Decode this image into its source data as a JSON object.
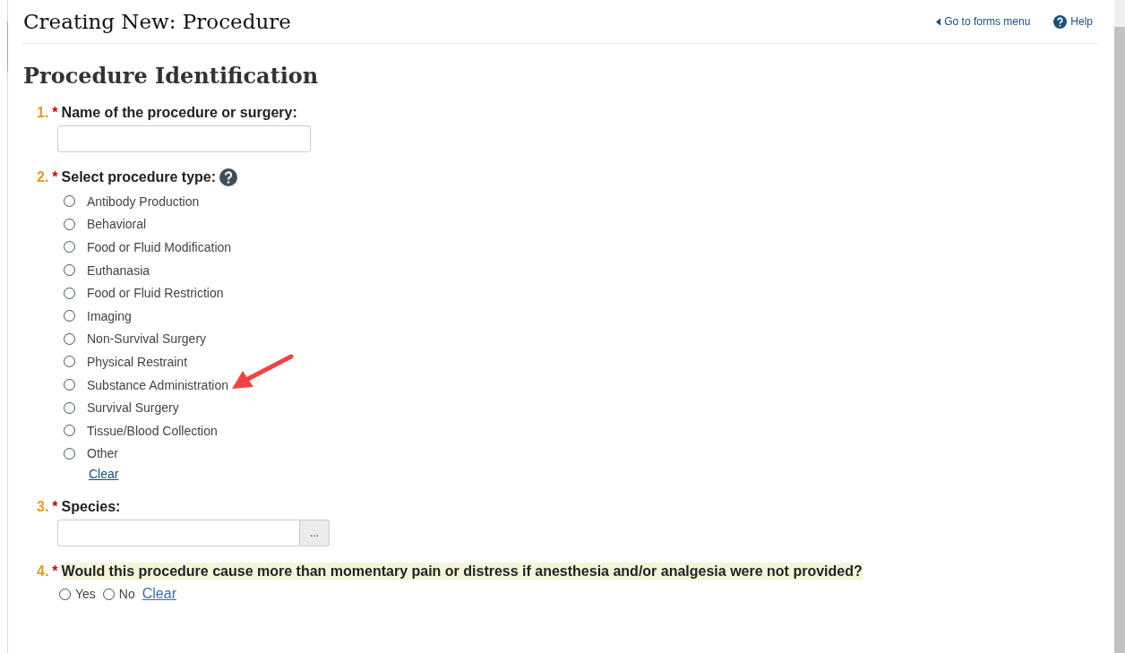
{
  "page_title": "Creating New: Procedure",
  "header_links": [
    {
      "kind": "back",
      "label": "Go to forms menu"
    },
    {
      "kind": "help",
      "label": "Help"
    }
  ],
  "section_title": "Procedure Identification",
  "questions": [
    {
      "kind": "text",
      "number": "1.",
      "marker": "*",
      "label": "Name of the procedure or surgery:",
      "help": false,
      "highlighted": false
    },
    {
      "kind": "radio-list",
      "number": "2.",
      "marker": "*",
      "label": "Select procedure type:",
      "help": true,
      "highlighted": false,
      "options": [
        {
          "label": "Antibody Production",
          "selected": false
        },
        {
          "label": "Behavioral",
          "selected": false
        },
        {
          "label": "Food or Fluid Modification",
          "selected": false
        },
        {
          "label": "Euthanasia",
          "selected": false
        },
        {
          "label": "Food or Fluid Restriction",
          "selected": false
        },
        {
          "label": "Imaging",
          "selected": false
        },
        {
          "label": "Non-Survival Surgery",
          "selected": false
        },
        {
          "label": "Physical Restraint",
          "selected": false
        },
        {
          "label": "Substance Administration",
          "selected": false,
          "pointer": true
        },
        {
          "label": "Survival Surgery",
          "selected": false
        },
        {
          "label": "Tissue/Blood Collection",
          "selected": false
        },
        {
          "label": "Other",
          "selected": false
        }
      ],
      "clear": "Clear"
    },
    {
      "kind": "lookup",
      "number": "3.",
      "marker": "*",
      "label": "Species:",
      "help": false,
      "highlighted": false,
      "button": "..."
    },
    {
      "kind": "radio-inline",
      "number": "4.",
      "marker": "*",
      "label": "Would this procedure cause more than momentary pain or distress if anesthesia and/or analgesia were not provided?",
      "help": false,
      "highlighted": true,
      "options": [
        {
          "label": "Yes",
          "selected": false
        },
        {
          "label": "No",
          "selected": false
        }
      ],
      "clear": "Clear"
    }
  ]
}
